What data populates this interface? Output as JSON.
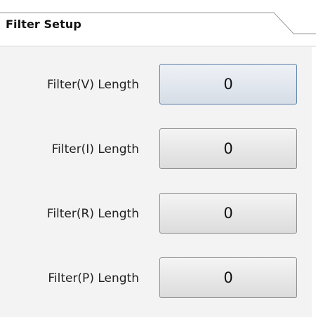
{
  "panel": {
    "title": "Filter Setup"
  },
  "rows": [
    {
      "label": "Filter(V) Length",
      "value": "0"
    },
    {
      "label": "Filter(I) Length",
      "value": "0"
    },
    {
      "label": "Filter(R) Length",
      "value": "0"
    },
    {
      "label": "Filter(P) Length",
      "value": "0"
    }
  ],
  "colors": {
    "body_bg": "#f3f3f3",
    "active_border": "#5a7fa8",
    "button_border": "#8a8a8a"
  }
}
